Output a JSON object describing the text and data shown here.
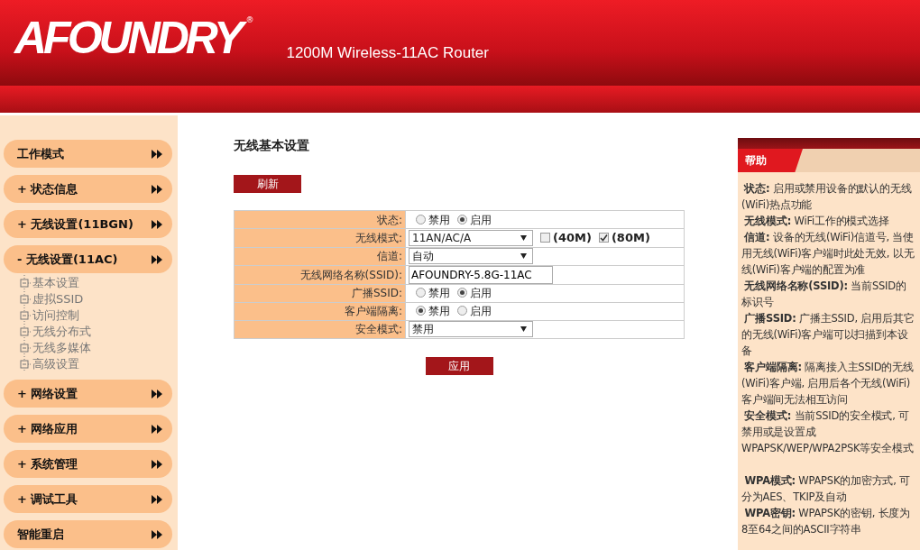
{
  "header": {
    "logo": "AFOUNDRY",
    "registered_mark": "®",
    "subtitle": "1200M Wireless-11AC Router"
  },
  "sidebar": {
    "items": [
      {
        "label": "工作模式"
      },
      {
        "label": "+ 状态信息"
      },
      {
        "label": "+ 无线设置(11BGN)"
      },
      {
        "label": "- 无线设置(11AC)",
        "children": [
          {
            "label": "基本设置"
          },
          {
            "label": "虚拟SSID"
          },
          {
            "label": "访问控制"
          },
          {
            "label": "无线分布式"
          },
          {
            "label": "无线多媒体"
          },
          {
            "label": "高级设置"
          }
        ]
      },
      {
        "label": "+ 网络设置"
      },
      {
        "label": "+ 网络应用"
      },
      {
        "label": "+ 系统管理"
      },
      {
        "label": "+ 调试工具"
      },
      {
        "label": "智能重启"
      }
    ]
  },
  "main": {
    "title": "无线基本设置",
    "refresh_button": "刷新",
    "apply_button": "应用",
    "rows": [
      {
        "kind": "radio",
        "label": "状态:",
        "options": [
          {
            "label": "禁用",
            "selected": false
          },
          {
            "label": "启用",
            "selected": true
          }
        ]
      },
      {
        "kind": "select",
        "label": "无线模式:",
        "value": "11AN/AC/A",
        "checkboxes": [
          {
            "label": "(40M)",
            "checked": false
          },
          {
            "label": "(80M)",
            "checked": true
          }
        ]
      },
      {
        "kind": "select",
        "label": "信道:",
        "value": "自动"
      },
      {
        "kind": "text",
        "label": "无线网络名称(SSID):",
        "value": "AFOUNDRY-5.8G-11AC"
      },
      {
        "kind": "radio",
        "label": "广播SSID:",
        "options": [
          {
            "label": "禁用",
            "selected": false
          },
          {
            "label": "启用",
            "selected": true
          }
        ]
      },
      {
        "kind": "radio",
        "label": "客户端隔离:",
        "options": [
          {
            "label": "禁用",
            "selected": true
          },
          {
            "label": "启用",
            "selected": false
          }
        ]
      },
      {
        "kind": "select",
        "label": "安全模式:",
        "value": "禁用"
      }
    ]
  },
  "help": {
    "title": "帮助",
    "entries": [
      "**状态:** 启用或禁用设备的默认的无线(WiFi)热点功能",
      "**无线模式:** WiFi工作的模式选择",
      "**信道:** 设备的无线(WiFi)信道号, 当使用无线(WiFi)客户端时此处无效, 以无线(WiFi)客户端的配置为准",
      "**无线网络名称(SSID):** 当前SSID的标识号",
      "**广播SSID:** 广播主SSID, 启用后其它的无线(WiFi)客户端可以扫描到本设备",
      "**客户端隔离:** 隔离接入主SSID的无线(WiFi)客户端, 启用后各个无线(WiFi)客户端间无法相互访问",
      "**安全模式:** 当前SSID的安全模式, 可禁用或是设置成WPAPSK/WEP/WPA2PSK等安全模式",
      "**WPA模式:** WPAPSK的加密方式, 可分为AES、TKIP及自动",
      "**WPA密钥:** WPAPSK的密钥, 长度为8至64之间的ASCII字符串"
    ]
  }
}
